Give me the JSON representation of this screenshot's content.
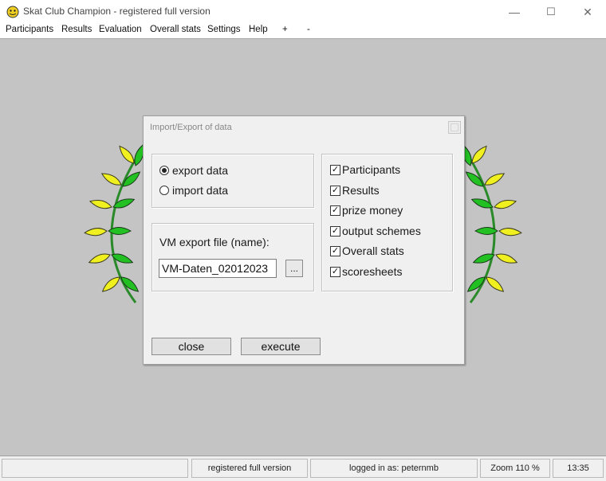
{
  "window": {
    "title": "Skat Club Champion - registered full version",
    "minimize": "—",
    "maximize": "☐",
    "close": "✕"
  },
  "menu": [
    "Participants",
    "Results",
    "Evaluation",
    "Overall stats",
    "Settings",
    "Help",
    "+",
    "-"
  ],
  "dialog": {
    "title": "Import/Export of data",
    "mode_options": [
      "export data",
      "import data"
    ],
    "selected_mode": "export data",
    "file_label": "VM export file (name):",
    "file_value": "VM-Daten_02012023",
    "browse_label": "...",
    "export_items": [
      "Participants",
      "Results",
      "prize money",
      "output schemes",
      "Overall stats",
      "scoresheets"
    ],
    "checked": [
      true,
      true,
      true,
      true,
      true,
      true
    ],
    "close_label": "close",
    "execute_label": "execute"
  },
  "status": {
    "version": "registered full version",
    "user": "logged in as: peternmb",
    "zoom": "Zoom 110 %",
    "time": "13:35"
  },
  "colors": {
    "background": "#c4c4c4",
    "dialog": "#f0f0f0",
    "laurel_leaf_yellow": "#f0f020",
    "laurel_leaf_green": "#22c022"
  }
}
